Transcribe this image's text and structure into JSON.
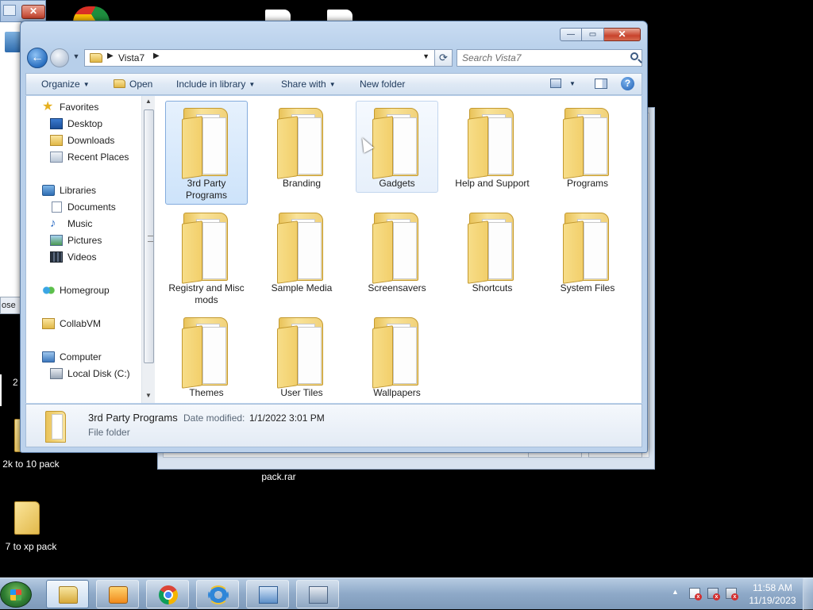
{
  "desktop": {
    "background_window_footer": "ose",
    "icons": [
      {
        "label": "2k to 10 pack",
        "icon": "folder-icon"
      },
      {
        "label": "pack.rar",
        "icon": "archive-icon"
      },
      {
        "label": "7 to xp pack",
        "icon": "folder-icon"
      }
    ],
    "partial_label": "2"
  },
  "explorer": {
    "caption": {
      "minimize": "—",
      "maximize": "▭",
      "close": "✕"
    },
    "nav": {
      "back": "←",
      "history": "▼"
    },
    "address": {
      "crumb": "Vista7",
      "sep1": "▶",
      "sep2": "▶",
      "dropdown": "▼"
    },
    "search": {
      "placeholder": "Search Vista7",
      "value": ""
    },
    "toolbar": {
      "organize": "Organize",
      "open": "Open",
      "include_in_library": "Include in library",
      "share_with": "Share with",
      "new_folder": "New folder",
      "help": "?"
    },
    "navpane": {
      "favorites": "Favorites",
      "desktop": "Desktop",
      "downloads": "Downloads",
      "recent_places": "Recent Places",
      "libraries": "Libraries",
      "documents": "Documents",
      "music": "Music",
      "pictures": "Pictures",
      "videos": "Videos",
      "homegroup": "Homegroup",
      "collabvm": "CollabVM",
      "computer": "Computer",
      "local_disk": "Local Disk (C:)"
    },
    "files": [
      {
        "name": "3rd Party Programs",
        "state": "selected"
      },
      {
        "name": "Branding",
        "state": "normal"
      },
      {
        "name": "Gadgets",
        "state": "hover"
      },
      {
        "name": "Help and Support",
        "state": "normal"
      },
      {
        "name": "Programs",
        "state": "normal"
      },
      {
        "name": "Registry and Misc mods",
        "state": "normal"
      },
      {
        "name": "Sample Media",
        "state": "normal"
      },
      {
        "name": "Screensavers",
        "state": "normal"
      },
      {
        "name": "Shortcuts",
        "state": "normal"
      },
      {
        "name": "System Files",
        "state": "normal"
      },
      {
        "name": "Themes",
        "state": "normal"
      },
      {
        "name": "User Tiles",
        "state": "normal"
      },
      {
        "name": "Wallpapers",
        "state": "normal"
      }
    ],
    "details": {
      "name": "3rd Party Programs",
      "date_modified_label": "Date modified:",
      "date_modified": "1/1/2022 3:01 PM",
      "type": "File folder"
    }
  },
  "taskbar": {
    "apps": [
      "windows-explorer",
      "media-player",
      "google-chrome",
      "internet-explorer",
      "remote-desktop",
      "setup"
    ],
    "tray_arrow": "▲",
    "clock": {
      "time": "11:58 AM",
      "date": "11/19/2023"
    }
  },
  "colors": {
    "selection": "#cde3fa",
    "accent": "#2a6fc0",
    "close_red": "#c8432c"
  }
}
